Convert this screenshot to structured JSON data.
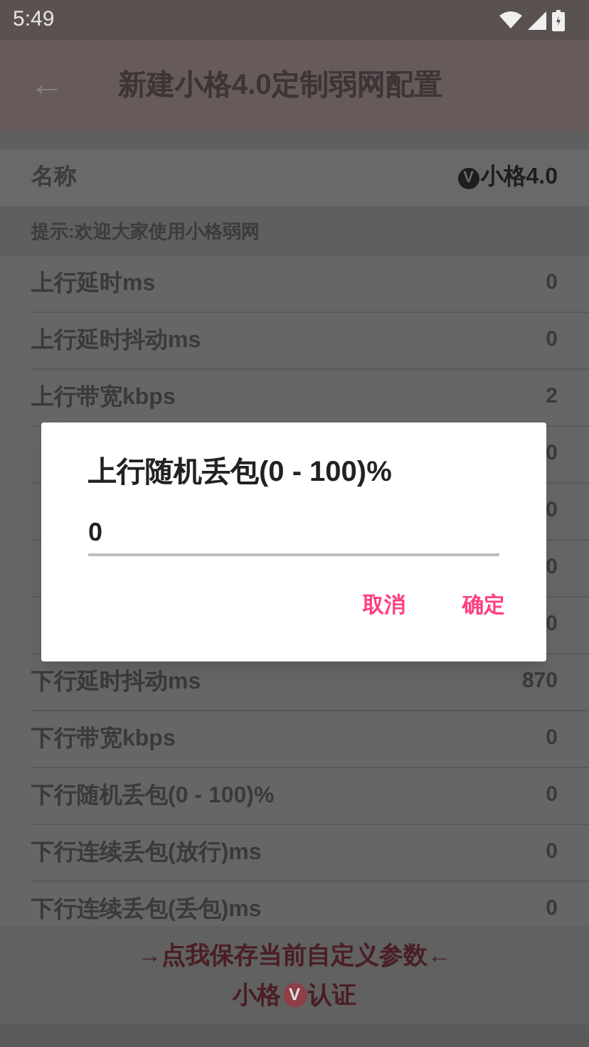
{
  "status_bar": {
    "time": "5:49"
  },
  "toolbar": {
    "back": "←",
    "title": "新建小格4.0定制弱网配置"
  },
  "name_row": {
    "label": "名称",
    "badge": "V",
    "value": "小格4.0"
  },
  "hint": "提示:欢迎大家使用小格弱网",
  "rows": [
    {
      "label": "上行延时ms",
      "value": "0"
    },
    {
      "label": "上行延时抖动ms",
      "value": "0"
    },
    {
      "label": "上行带宽kbps",
      "value": "2"
    },
    {
      "value": "0"
    },
    {
      "value": "0"
    },
    {
      "value": "0"
    },
    {
      "value": "0"
    },
    {
      "label": "下行延时抖动ms",
      "value": "870"
    },
    {
      "label": "下行带宽kbps",
      "value": "0"
    },
    {
      "label": "下行随机丢包(0 - 100)%",
      "value": "0"
    },
    {
      "label": "下行连续丢包(放行)ms",
      "value": "0"
    },
    {
      "label": "下行连续丢包(丢包)ms",
      "value": "0"
    }
  ],
  "footer": {
    "save": "→点我保存当前自定义参数←",
    "cert_prefix": "小格",
    "cert_badge": "V",
    "cert_suffix": "认证"
  },
  "dialog": {
    "title": "上行随机丢包(0 - 100)%",
    "input_value": "0",
    "buttons": [
      {
        "label": "取消"
      },
      {
        "label": "确定"
      }
    ]
  }
}
